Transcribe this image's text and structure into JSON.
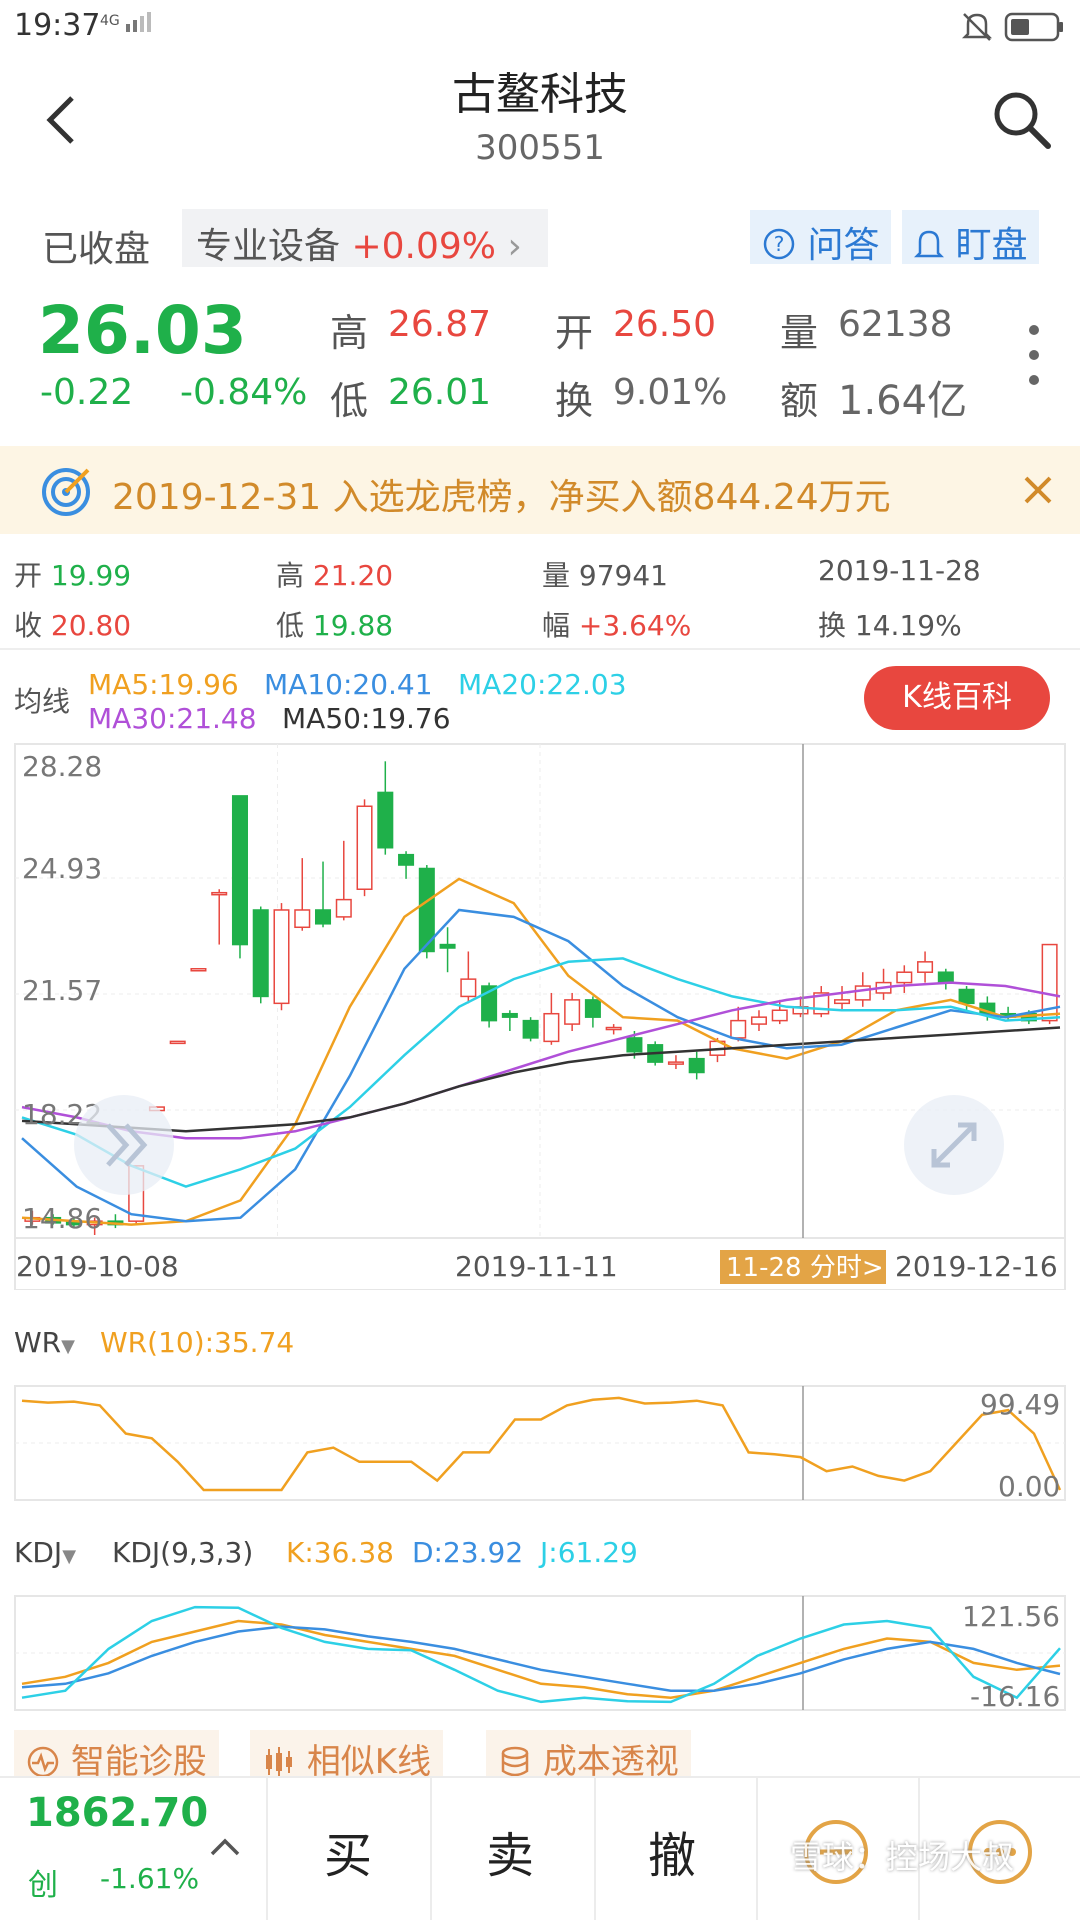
{
  "status": {
    "time": "19:37",
    "signal": "4G"
  },
  "header": {
    "title": "古鳌科技",
    "code": "300551"
  },
  "tags": {
    "market_status": "已收盘",
    "sector_name": "专业设备",
    "sector_change": "+0.09%",
    "qa_label": "问答",
    "watch_label": "盯盘"
  },
  "quote": {
    "price": "26.03",
    "change": "-0.22",
    "change_pct": "-0.84%",
    "high_label": "高",
    "high": "26.87",
    "low_label": "低",
    "low": "26.01",
    "open_label": "开",
    "open": "26.50",
    "turnover_label": "换",
    "turnover": "9.01%",
    "volume_label": "量",
    "volume": "62138",
    "amount_label": "额",
    "amount": "1.64亿"
  },
  "banner": {
    "text": "2019-12-31 入选龙虎榜，净买入额844.24万元"
  },
  "day_info": {
    "open_label": "开",
    "open": "19.99",
    "close_label": "收",
    "close": "20.80",
    "high_label": "高",
    "high": "21.20",
    "low_label": "低",
    "low": "19.88",
    "volume_label": "量",
    "volume": "97941",
    "amp_label": "幅",
    "amplitude": "+3.64%",
    "date": "2019-11-28",
    "turnover_label": "换",
    "turnover": "14.19%"
  },
  "ma": {
    "label": "均线",
    "ma5": "MA5:19.96",
    "ma10": "MA10:20.41",
    "ma20": "MA20:22.03",
    "ma30": "MA30:21.48",
    "ma50": "MA50:19.76",
    "wiki_button": "K线百科"
  },
  "kline": {
    "y_labels": [
      "28.28",
      "24.93",
      "21.57",
      "18.22",
      "14.86"
    ],
    "x_labels": [
      "2019-10-08",
      "2019-11-11",
      "2019-12-16"
    ],
    "intraday_tag": "11-28 分时>"
  },
  "wr": {
    "label": "WR",
    "value": "WR(10):35.74",
    "max": "99.49",
    "min": "0.00"
  },
  "kdj": {
    "label": "KDJ",
    "params": "KDJ(9,3,3)",
    "k": "K:36.38",
    "d": "D:23.92",
    "j": "J:61.29",
    "max": "121.56",
    "min": "-16.16"
  },
  "tools": {
    "diagnose": "智能诊股",
    "similar": "相似K线",
    "cost": "成本透视"
  },
  "bottom": {
    "index_value": "1862.70",
    "index_name": "创",
    "index_change": "-1.61%",
    "buy": "买",
    "sell": "卖",
    "cancel": "撤",
    "watermark": "雪球：控场大叔"
  },
  "colors": {
    "red": "#e8473f",
    "green": "#1fb04a",
    "ma5": "#f0a020",
    "ma10": "#3a8ee0",
    "ma20": "#2dd0e6",
    "ma30": "#b050d8",
    "ma50": "#333333"
  },
  "chart_data": {
    "type": "line",
    "x_range": [
      "2019-10-08",
      "2019-12-16"
    ],
    "ylim": [
      14.86,
      28.28
    ],
    "series": [
      {
        "name": "MA5",
        "values": [
          15.1,
          15.0,
          14.9,
          15.0,
          15.6,
          17.8,
          21.2,
          23.8,
          24.9,
          24.2,
          22.1,
          20.9,
          20.8,
          20.0,
          19.7,
          20.2,
          21.1,
          21.4,
          20.9,
          21.0
        ]
      },
      {
        "name": "MA10",
        "values": [
          17.4,
          16.0,
          15.2,
          15.0,
          15.1,
          16.5,
          19.2,
          22.3,
          24.0,
          23.8,
          23.1,
          21.8,
          20.9,
          20.3,
          20.0,
          20.1,
          20.6,
          21.1,
          20.9,
          21.2
        ]
      },
      {
        "name": "MA20",
        "values": [
          18.0,
          17.5,
          16.6,
          16.0,
          16.5,
          17.1,
          18.3,
          19.8,
          21.2,
          22.0,
          22.5,
          22.6,
          22.0,
          21.5,
          21.2,
          21.1,
          21.1,
          21.2,
          20.8,
          20.9
        ]
      },
      {
        "name": "MA30",
        "values": [
          18.3,
          18.0,
          17.6,
          17.4,
          17.4,
          17.6,
          18.0,
          18.4,
          18.9,
          19.4,
          19.9,
          20.3,
          20.7,
          21.1,
          21.4,
          21.6,
          21.8,
          21.9,
          21.8,
          21.5
        ]
      },
      {
        "name": "MA50",
        "values": [
          17.9,
          17.8,
          17.7,
          17.6,
          17.7,
          17.8,
          18.0,
          18.4,
          18.9,
          19.3,
          19.6,
          19.8,
          19.9,
          20.0,
          20.1,
          20.2,
          20.3,
          20.4,
          20.5,
          20.6
        ]
      }
    ],
    "candles": [
      {
        "o": 15.0,
        "c": 15.1,
        "h": 15.3,
        "l": 14.9
      },
      {
        "o": 15.1,
        "c": 14.95,
        "h": 15.2,
        "l": 14.9
      },
      {
        "o": 15.0,
        "c": 14.9,
        "h": 15.1,
        "l": 14.8
      },
      {
        "o": 14.9,
        "c": 15.0,
        "h": 15.1,
        "l": 14.6
      },
      {
        "o": 15.0,
        "c": 14.9,
        "h": 15.2,
        "l": 14.8
      },
      {
        "o": 15.0,
        "c": 16.6,
        "h": 16.6,
        "l": 14.9
      },
      {
        "o": 18.2,
        "c": 18.3,
        "h": 18.3,
        "l": 18.2
      },
      {
        "o": 20.2,
        "c": 20.2,
        "h": 20.2,
        "l": 20.2
      },
      {
        "o": 22.3,
        "c": 22.3,
        "h": 22.3,
        "l": 22.3
      },
      {
        "o": 24.5,
        "c": 24.5,
        "h": 24.6,
        "l": 23.0
      },
      {
        "o": 27.3,
        "c": 23.0,
        "h": 27.3,
        "l": 22.6
      },
      {
        "o": 24.0,
        "c": 21.5,
        "h": 24.1,
        "l": 21.3
      },
      {
        "o": 21.3,
        "c": 24.0,
        "h": 24.2,
        "l": 21.1
      },
      {
        "o": 23.5,
        "c": 24.0,
        "h": 25.5,
        "l": 23.4
      },
      {
        "o": 24.0,
        "c": 23.6,
        "h": 25.4,
        "l": 23.5
      },
      {
        "o": 23.8,
        "c": 24.3,
        "h": 26.0,
        "l": 23.7
      },
      {
        "o": 24.6,
        "c": 27.0,
        "h": 27.2,
        "l": 24.4
      },
      {
        "o": 27.4,
        "c": 25.8,
        "h": 28.3,
        "l": 25.6
      },
      {
        "o": 25.6,
        "c": 25.3,
        "h": 25.7,
        "l": 24.9
      },
      {
        "o": 25.2,
        "c": 22.8,
        "h": 25.3,
        "l": 22.6
      },
      {
        "o": 23.0,
        "c": 22.9,
        "h": 23.5,
        "l": 22.2
      },
      {
        "o": 21.5,
        "c": 22.0,
        "h": 22.8,
        "l": 21.3
      },
      {
        "o": 21.8,
        "c": 20.8,
        "h": 21.9,
        "l": 20.6
      },
      {
        "o": 21.0,
        "c": 20.9,
        "h": 21.1,
        "l": 20.5
      },
      {
        "o": 20.8,
        "c": 20.3,
        "h": 20.9,
        "l": 20.2
      },
      {
        "o": 20.2,
        "c": 21.0,
        "h": 21.6,
        "l": 20.1
      },
      {
        "o": 20.7,
        "c": 21.4,
        "h": 21.6,
        "l": 20.5
      },
      {
        "o": 21.4,
        "c": 20.9,
        "h": 21.5,
        "l": 20.6
      },
      {
        "o": 20.6,
        "c": 20.6,
        "h": 20.7,
        "l": 20.4
      },
      {
        "o": 20.3,
        "c": 19.9,
        "h": 20.5,
        "l": 19.7
      },
      {
        "o": 20.1,
        "c": 19.6,
        "h": 20.2,
        "l": 19.5
      },
      {
        "o": 19.6,
        "c": 19.6,
        "h": 19.8,
        "l": 19.4
      },
      {
        "o": 19.7,
        "c": 19.3,
        "h": 19.9,
        "l": 19.1
      },
      {
        "o": 19.8,
        "c": 20.2,
        "h": 20.3,
        "l": 19.6
      },
      {
        "o": 20.3,
        "c": 20.8,
        "h": 21.2,
        "l": 20.2
      },
      {
        "o": 20.7,
        "c": 20.9,
        "h": 21.1,
        "l": 20.5
      },
      {
        "o": 20.8,
        "c": 21.1,
        "h": 21.4,
        "l": 20.7
      },
      {
        "o": 21.0,
        "c": 21.2,
        "h": 21.5,
        "l": 20.9
      },
      {
        "o": 21.0,
        "c": 21.6,
        "h": 21.8,
        "l": 20.9
      },
      {
        "o": 21.3,
        "c": 21.4,
        "h": 21.8,
        "l": 21.1
      },
      {
        "o": 21.4,
        "c": 21.8,
        "h": 22.2,
        "l": 21.2
      },
      {
        "o": 21.6,
        "c": 21.9,
        "h": 22.3,
        "l": 21.4
      },
      {
        "o": 21.9,
        "c": 22.2,
        "h": 22.4,
        "l": 21.6
      },
      {
        "o": 22.2,
        "c": 22.5,
        "h": 22.8,
        "l": 21.9
      },
      {
        "o": 22.2,
        "c": 21.9,
        "h": 22.3,
        "l": 21.7
      },
      {
        "o": 21.7,
        "c": 21.3,
        "h": 21.8,
        "l": 21.1
      },
      {
        "o": 21.3,
        "c": 21.0,
        "h": 21.5,
        "l": 20.8
      },
      {
        "o": 21.0,
        "c": 20.9,
        "h": 21.2,
        "l": 20.8
      },
      {
        "o": 21.0,
        "c": 20.8,
        "h": 21.1,
        "l": 20.7
      },
      {
        "o": 20.8,
        "c": 23.0,
        "h": 23.0,
        "l": 20.7
      }
    ],
    "wr": [
      95,
      93,
      94,
      90,
      60,
      55,
      30,
      0,
      0,
      0,
      0,
      40,
      45,
      30,
      30,
      30,
      10,
      40,
      40,
      75,
      75,
      90,
      96,
      98,
      92,
      93,
      95,
      90,
      40,
      38,
      35,
      20,
      25,
      15,
      10,
      20,
      50,
      80,
      85,
      60,
      0
    ],
    "kdj": {
      "K": [
        10,
        20,
        40,
        70,
        85,
        100,
        95,
        80,
        70,
        60,
        50,
        30,
        10,
        5,
        -5,
        -10,
        0,
        20,
        40,
        60,
        75,
        70,
        40,
        30,
        36
      ],
      "D": [
        5,
        10,
        25,
        50,
        70,
        85,
        92,
        88,
        78,
        70,
        60,
        45,
        30,
        20,
        10,
        0,
        0,
        10,
        25,
        45,
        60,
        70,
        60,
        40,
        24
      ],
      "J": [
        -10,
        0,
        60,
        100,
        120,
        119,
        90,
        70,
        60,
        58,
        30,
        0,
        -16,
        -10,
        -15,
        -16,
        10,
        50,
        75,
        95,
        100,
        90,
        20,
        -10,
        61
      ]
    }
  }
}
